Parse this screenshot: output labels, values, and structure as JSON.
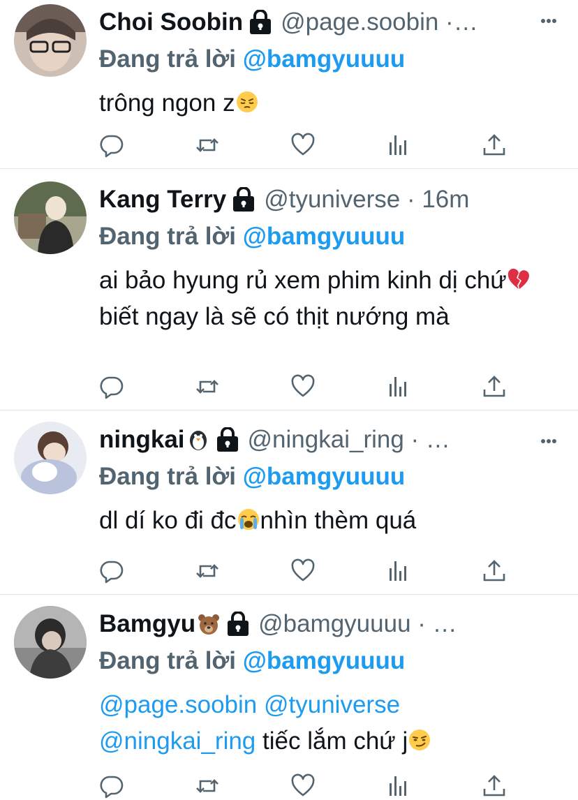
{
  "replies": [
    {
      "name": "Choi Soobin",
      "handle_meta": "@page.soobin ·…",
      "replying_label": "Đang trả lời",
      "replying_to": "@bamgyuuuu",
      "text": "trông ngon z",
      "text_emoji": "pensive-face",
      "avatar_colors": [
        "#6b5d55",
        "#cdbfb3"
      ]
    },
    {
      "name": "Kang Terry",
      "handle_meta": "@tyuniverse · 16m",
      "replying_label": "Đang trả lời",
      "replying_to": "@bamgyuuuu",
      "text_a": "ai bảo hyung rủ xem phim kinh dị chứ",
      "text_emoji": "broken-heart",
      "text_b": "biết ngay là sẽ có thịt nướng mà",
      "avatar_colors": [
        "#5f6b4e",
        "#2a2a2a"
      ]
    },
    {
      "name": "ningkai",
      "name_emoji": "penguin",
      "handle_meta": "@ningkai_ring · …",
      "replying_label": "Đang trả lời",
      "replying_to": "@bamgyuuuu",
      "text_a": "dl dí ko đi đc",
      "text_emoji": "loudly-crying-face",
      "text_b": "nhìn thèm quá",
      "avatar_colors": [
        "#b9c4dc",
        "#e9ebf2"
      ]
    },
    {
      "name": "Bamgyu",
      "name_emoji": "bear-face",
      "handle_meta": "@bamgyuuuu · …",
      "replying_label": "Đang trả lời",
      "replying_to": "@bamgyuuuu",
      "mention_1": "@page.soobin",
      "mention_2": "@tyuniverse",
      "mention_3": "@ningkai_ring",
      "text": "tiếc lắm chứ j",
      "text_emoji": "smirking-face",
      "avatar_colors": [
        "#3d3d3d",
        "#8a8a8a"
      ]
    }
  ],
  "icons": {
    "lock": "lock-icon",
    "more": "more-icon",
    "reply": "reply-icon",
    "retweet": "retweet-icon",
    "like": "like-icon",
    "views": "views-icon",
    "share": "share-icon"
  },
  "colors": {
    "accent": "#1d9bf0",
    "secondary_text": "#536471",
    "icon": "#536471",
    "divider": "#e1e4e8"
  }
}
